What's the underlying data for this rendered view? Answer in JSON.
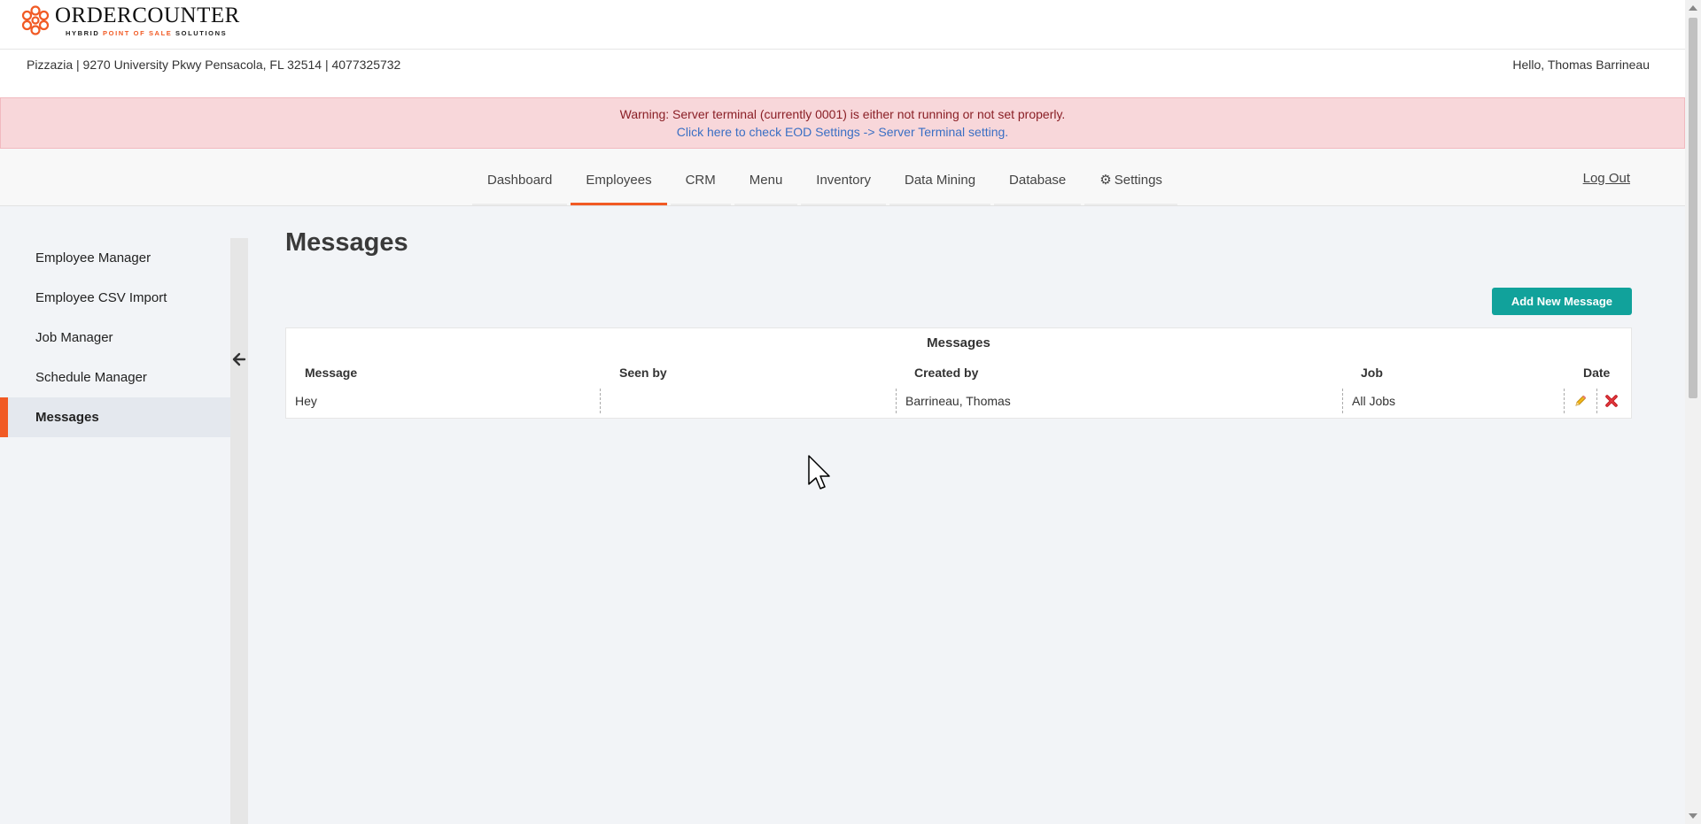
{
  "logo": {
    "title": "ORDERCOUNTER",
    "subtitle_a": "HYBRID ",
    "subtitle_b": "POINT OF SALE",
    "subtitle_c": " SOLUTIONS",
    "icon": "flower-logo-icon",
    "color": "#f15a24"
  },
  "header": {
    "store_info": "Pizzazia | 9270 University Pkwy Pensacola, FL 32514 | 4077325732",
    "greeting": "Hello, Thomas Barrineau"
  },
  "warning": {
    "message": "Warning: Server terminal (currently 0001) is either not running or not set properly.",
    "link": "Click here to check EOD Settings -> Server Terminal setting."
  },
  "nav": {
    "items": [
      {
        "label": "Dashboard"
      },
      {
        "label": "Employees"
      },
      {
        "label": "CRM"
      },
      {
        "label": "Menu"
      },
      {
        "label": "Inventory"
      },
      {
        "label": "Data Mining"
      },
      {
        "label": "Database"
      },
      {
        "label": "Settings"
      }
    ],
    "active": "Employees",
    "logout": "Log Out"
  },
  "sidebar": {
    "items": [
      {
        "label": "Employee Manager"
      },
      {
        "label": "Employee CSV Import"
      },
      {
        "label": "Job Manager"
      },
      {
        "label": "Schedule Manager"
      },
      {
        "label": "Messages"
      }
    ],
    "active": "Messages"
  },
  "main": {
    "title": "Messages",
    "add_button": "Add New Message",
    "table": {
      "title": "Messages",
      "columns": [
        "Message",
        "Seen by",
        "Created by",
        "Job",
        "Date"
      ],
      "rows": [
        {
          "message": "Hey",
          "seen_by": "",
          "created_by": "Barrineau, Thomas",
          "job": "All Jobs",
          "date": ""
        }
      ]
    }
  },
  "colors": {
    "accent": "#f15a24",
    "button": "#11a29b",
    "warning_bg": "#f8d7da",
    "link": "#3a6fc4"
  }
}
